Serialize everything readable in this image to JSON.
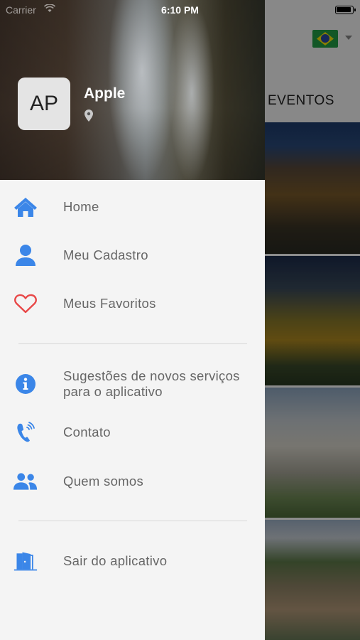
{
  "status_bar": {
    "carrier": "Carrier",
    "time": "6:10 PM"
  },
  "user": {
    "initials": "AP",
    "name": "Apple"
  },
  "menu": {
    "primary": [
      {
        "label": "Home",
        "icon": "home-icon"
      },
      {
        "label": "Meu Cadastro",
        "icon": "user-icon"
      },
      {
        "label": "Meus Favoritos",
        "icon": "heart-icon"
      }
    ],
    "secondary": [
      {
        "label": "Sugestões de novos serviços para o aplicativo",
        "icon": "info-icon"
      },
      {
        "label": "Contato",
        "icon": "phone-icon"
      },
      {
        "label": "Quem somos",
        "icon": "users-icon"
      }
    ],
    "exit": {
      "label": "Sair do aplicativo",
      "icon": "exit-door-icon"
    }
  },
  "background_screen": {
    "tab_label": "EVENTOS",
    "language_flag": "brazil-flag-icon"
  },
  "colors": {
    "accent_blue": "#3b86e8",
    "heart_red": "#e84848",
    "drawer_bg": "#f4f4f4",
    "label_gray": "#666666"
  }
}
